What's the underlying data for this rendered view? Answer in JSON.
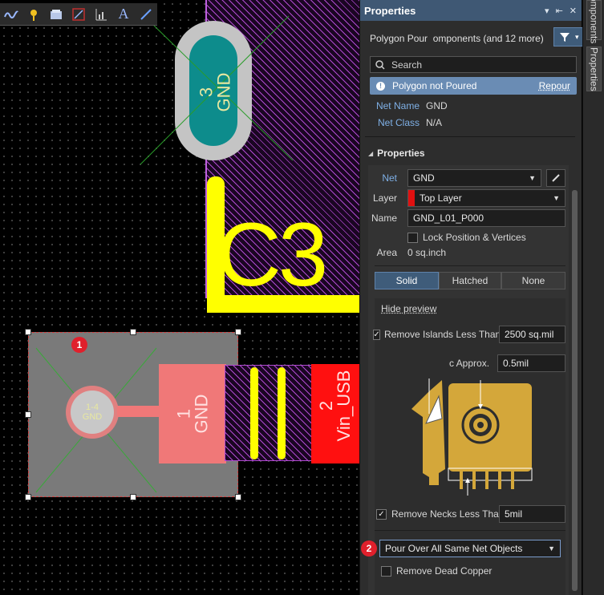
{
  "toolbar": {
    "tools": [
      "route-icon",
      "pin-icon",
      "board-icon",
      "graph-icon",
      "chart-icon",
      "text-tool-icon",
      "line-tool-icon"
    ],
    "text_tool": "A"
  },
  "canvas": {
    "pad_top": {
      "number": "3",
      "net": "GND"
    },
    "silk_label": "C3",
    "pad_left": {
      "number": "1-4",
      "net": "GND"
    },
    "pad_mid": {
      "number": "1",
      "net": "GND"
    },
    "pad_right": {
      "number": "2",
      "net": "Vin_USB"
    },
    "badge_1": "1"
  },
  "panel": {
    "title": "Properties",
    "header_icons": [
      "▾",
      "⇤",
      "✕"
    ],
    "filter_summary": "Polygon Pour  omponents (and 12 more)",
    "search_placeholder": "Search",
    "status": {
      "text": "Polygon not Poured",
      "action": "Repour"
    },
    "net_name_label": "Net Name",
    "net_name_value": "GND",
    "net_class_label": "Net Class",
    "net_class_value": "N/A",
    "section_title": "Properties",
    "net_label": "Net",
    "net_value": "GND",
    "layer_label": "Layer",
    "layer_value": "Top Layer",
    "layer_color": "#e01010",
    "name_label": "Name",
    "name_value": "GND_L01_P000",
    "lock_label": "Lock Position & Vertices",
    "area_label": "Area",
    "area_value": "0 sq.inch",
    "fill_modes": [
      "Solid",
      "Hatched",
      "None"
    ],
    "fill_active": "Solid",
    "hide_preview": "Hide preview",
    "remove_islands_label": "Remove Islands Less Than",
    "remove_islands_value": "2500 sq.mil",
    "arc_approx_label": "c Approx.",
    "arc_approx_value": "0.5mil",
    "remove_necks_label": "Remove Necks Less Than",
    "remove_necks_value": "5mil",
    "badge_2": "2",
    "pour_over_value": "Pour Over All Same Net Objects",
    "remove_dead_label": "Remove Dead Copper"
  },
  "side_tabs": [
    "omponents",
    "Properties"
  ],
  "colors": {
    "panel_header": "#3f5874",
    "status_bar": "#6a8cb4",
    "pad_teal": "#0d8c8c",
    "silk_yellow": "#ffff00",
    "copper_salmon": "#f07878",
    "copper_red": "#ff1010",
    "preview_gold": "#d4a73a"
  }
}
